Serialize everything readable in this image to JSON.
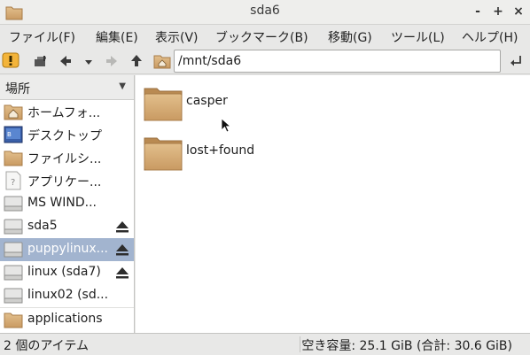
{
  "window": {
    "title": "sda6",
    "minimize": "-",
    "maximize": "+",
    "close": "×"
  },
  "menubar": {
    "items": [
      "ファイル(F)",
      "編集(E)",
      "表示(V)",
      "ブックマーク(B)",
      "移動(G)",
      "ツール(L)",
      "ヘルプ(H)"
    ]
  },
  "toolbar": {
    "location_value": "/mnt/sda6"
  },
  "sidebar": {
    "header": "場所",
    "places": [
      {
        "label": "ホームフォ...",
        "icon": "home-folder-icon",
        "eject": false,
        "selected": false
      },
      {
        "label": "デスクトップ",
        "icon": "desktop-icon",
        "eject": false,
        "selected": false
      },
      {
        "label": "ファイルシ...",
        "icon": "filesystem-folder-icon",
        "eject": false,
        "selected": false
      },
      {
        "label": "アプリケー...",
        "icon": "applications-icon",
        "eject": false,
        "selected": false
      },
      {
        "label": "MS WIND...",
        "icon": "drive-icon",
        "eject": false,
        "selected": false
      },
      {
        "label": "sda5",
        "icon": "drive-icon",
        "eject": true,
        "selected": false
      },
      {
        "label": "puppylinux...",
        "icon": "drive-icon",
        "eject": true,
        "selected": true
      },
      {
        "label": "linux (sda7)",
        "icon": "drive-icon",
        "eject": true,
        "selected": false
      },
      {
        "label": "linux02 (sd...",
        "icon": "drive-icon",
        "eject": false,
        "selected": false
      },
      {
        "label": "applications",
        "icon": "bookmark-folder-icon",
        "eject": false,
        "selected": false
      }
    ]
  },
  "main": {
    "files": [
      {
        "name": "casper",
        "icon": "folder-icon"
      },
      {
        "name": "lost+found",
        "icon": "folder-icon"
      }
    ]
  },
  "statusbar": {
    "item_count": "2 個のアイテム",
    "free_space": "空き容量: 25.1 GiB (合計: 30.6 GiB)"
  },
  "colors": {
    "selection": "#a2b4cf",
    "folder": "#d6ad78",
    "chrome": "#e8e8e7"
  }
}
